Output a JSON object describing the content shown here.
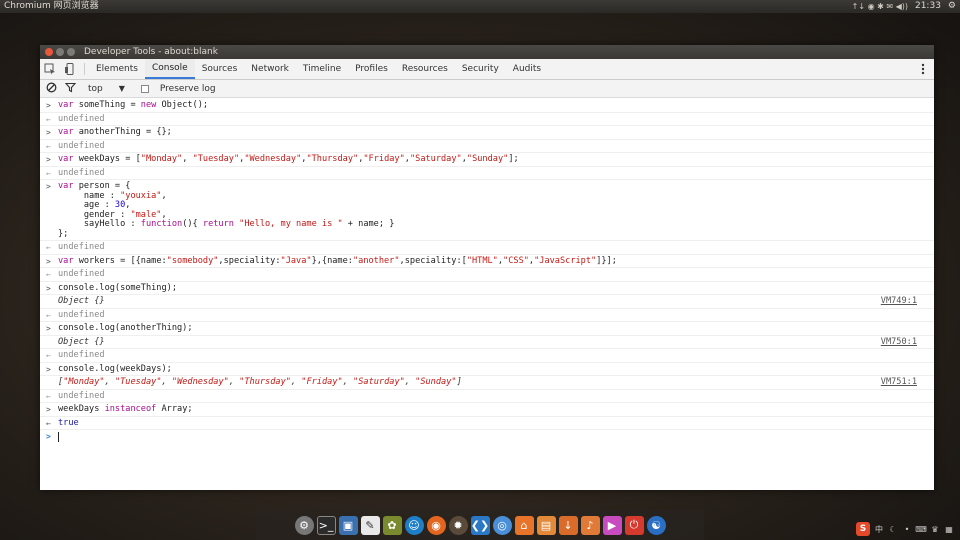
{
  "system": {
    "app_title": "Chromium 网页浏览器",
    "tray_icons": "↑↓ ◉ ✱ ✉ ◀))",
    "clock": "21:33",
    "power_icon": "⚙"
  },
  "window": {
    "title": "Developer Tools - about:blank"
  },
  "tabs": [
    {
      "label": "Elements"
    },
    {
      "label": "Console"
    },
    {
      "label": "Sources"
    },
    {
      "label": "Network"
    },
    {
      "label": "Timeline"
    },
    {
      "label": "Profiles"
    },
    {
      "label": "Resources"
    },
    {
      "label": "Security"
    },
    {
      "label": "Audits"
    }
  ],
  "toolbar": {
    "context": "top",
    "preserve_log_label": "Preserve log"
  },
  "console": {
    "undefined": "undefined",
    "l1": {
      "a": "var",
      "b": " someThing = ",
      "c": "new",
      "d": " Object();"
    },
    "l2": {
      "a": "var",
      "b": " anotherThing = {};"
    },
    "l3": {
      "a": "var",
      "b": " weekDays = [",
      "s1": "\"Monday\"",
      "c1": ", ",
      "s2": "\"Tuesday\"",
      "c2": ",",
      "s3": "\"Wednesday\"",
      "c3": ",",
      "s4": "\"Thursday\"",
      "c4": ",",
      "s5": "\"Friday\"",
      "c5": ",",
      "s6": "\"Saturday\"",
      "c6": ",",
      "s7": "\"Sunday\"",
      "e": "];"
    },
    "l4": {
      "a": "var",
      "b": " person = {",
      "n1": "     name : ",
      "n2": "\"youxia\"",
      "n3": ",",
      "g1": "     age : ",
      "g2": "30",
      "g3": ",",
      "ge1": "     gender : ",
      "ge2": "\"male\"",
      "ge3": ",",
      "h1": "     sayHello : ",
      "h2": "function",
      "h3": "(){ ",
      "h4": "return",
      "h5": " ",
      "h6": "\"Hello, my name is \"",
      "h7": " + name; }",
      "end": "};"
    },
    "l5": {
      "a": "var",
      "b": " workers = [{name:",
      "s1": "\"somebody\"",
      "c1": ",speciality:",
      "s2": "\"Java\"",
      "c2": "},{name:",
      "s3": "\"another\"",
      "c3": ",speciality:[",
      "s4": "\"HTML\"",
      "c4": ",",
      "s5": "\"CSS\"",
      "c5": ",",
      "s6": "\"JavaScript\"",
      "e": "]}];"
    },
    "l6": {
      "cmd": "console.log(someThing);",
      "out": "Object {}",
      "src": "VM749:1"
    },
    "l7": {
      "cmd": "console.log(anotherThing);",
      "out": "Object {}",
      "src": "VM750:1"
    },
    "l8": {
      "cmd": "console.log(weekDays);",
      "o0": "[",
      "o1": "\"Monday\"",
      "oc": ", ",
      "o2": "\"Tuesday\"",
      "o3": "\"Wednesday\"",
      "o4": "\"Thursday\"",
      "o5": "\"Friday\"",
      "o6": "\"Saturday\"",
      "o7": "\"Sunday\"",
      "oe": "]",
      "src": "VM751:1"
    },
    "l9": {
      "a": "weekDays ",
      "b": "instanceof",
      "c": " Array;",
      "out": "true"
    }
  }
}
